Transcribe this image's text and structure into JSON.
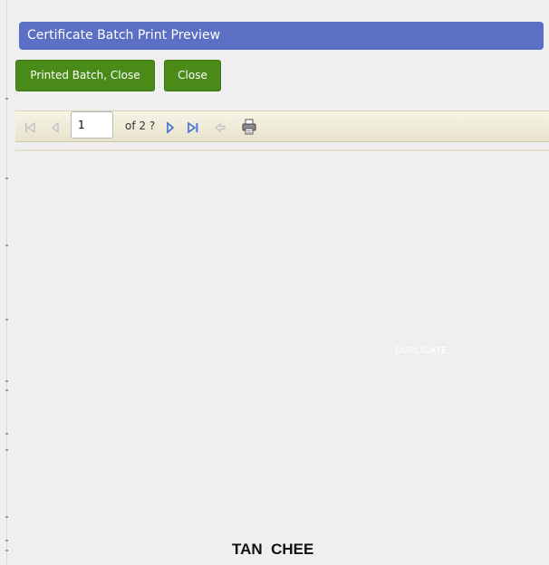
{
  "window": {
    "title": "Certificate Batch Print Preview"
  },
  "actions": {
    "printed_close_label": "Printed Batch, Close",
    "close_label": "Close",
    "button_color": "#4a8a18"
  },
  "toolbar": {
    "page_value": "1",
    "page_of": "of 2 ?",
    "icons": [
      "first-page-icon",
      "previous-page-icon",
      "next-page-icon",
      "last-page-icon",
      "back-icon",
      "print-icon"
    ]
  },
  "preview": {
    "watermark": "DUPLICATE",
    "recipient_name": "TAN  CHEE"
  },
  "colors": {
    "title_bar": "#5b6fc4",
    "background": "#efefef"
  }
}
